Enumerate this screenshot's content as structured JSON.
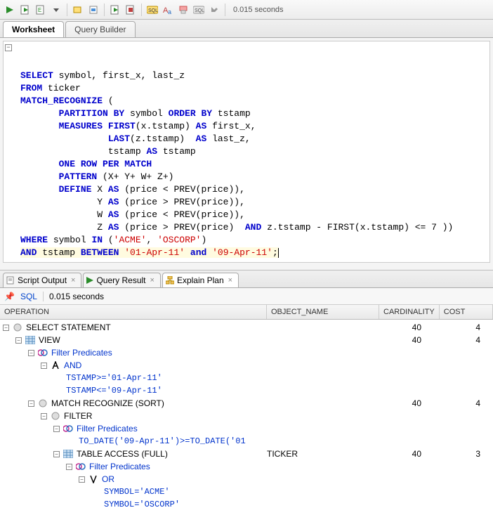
{
  "toolbar": {
    "time": "0.015 seconds"
  },
  "ws_tabs": {
    "worksheet": "Worksheet",
    "query_builder": "Query Builder"
  },
  "sql": {
    "l1a": "SELECT",
    "l1b": " symbol, first_x, last_z",
    "l2a": "FROM",
    "l2b": " ticker",
    "l3a": "MATCH_RECOGNIZE",
    "l3b": " (",
    "l4a": "       PARTITION BY",
    "l4b": " symbol ",
    "l4c": "ORDER BY",
    "l4d": " tstamp",
    "l5a": "       MEASURES",
    "l5b": " FIRST",
    "l5c": "(x.tstamp) ",
    "l5d": "AS",
    "l5e": " first_x,",
    "l6a": "                LAST",
    "l6b": "(z.tstamp)  ",
    "l6c": "AS",
    "l6d": " last_z,",
    "l7a": "                tstamp ",
    "l7b": "AS",
    "l7c": " tstamp",
    "l8a": "       ONE ROW PER MATCH",
    "l9a": "       PATTERN",
    "l9b": " (X+ Y+ W+ Z+)",
    "l10a": "       DEFINE",
    "l10b": " X ",
    "l10c": "AS",
    "l10d": " (price < PREV(price)),",
    "l11a": "              Y ",
    "l11b": "AS",
    "l11c": " (price > PREV(price)),",
    "l12a": "              W ",
    "l12b": "AS",
    "l12c": " (price < PREV(price)),",
    "l13a": "              Z ",
    "l13b": "AS",
    "l13c": " (price > PREV(price)  ",
    "l13d": "AND",
    "l13e": " z.tstamp - FIRST(x.tstamp) <= 7 ))",
    "l14a": "WHERE",
    "l14b": " symbol ",
    "l14c": "IN",
    "l14d": " (",
    "l14e": "'ACME'",
    "l14f": ", ",
    "l14g": "'OSCORP'",
    "l14h": ")",
    "l15a": "AND",
    "l15b": " tstamp ",
    "l15c": "BETWEEN",
    "l15d": " ",
    "l15e": "'01-Apr-11'",
    "l15f": " ",
    "l15g": "and",
    "l15h": " ",
    "l15i": "'09-Apr-11'",
    "l15j": ";"
  },
  "res_tabs": {
    "script_output": "Script Output",
    "query_result": "Query Result",
    "explain_plan": "Explain Plan"
  },
  "status": {
    "sql": "SQL",
    "time": "0.015 seconds"
  },
  "plan_cols": {
    "operation": "OPERATION",
    "object": "OBJECT_NAME",
    "card": "CARDINALITY",
    "cost": "COST"
  },
  "plan": {
    "r1": {
      "op": "SELECT STATEMENT",
      "card": "40",
      "cost": "4"
    },
    "r2": {
      "op": "VIEW",
      "card": "40",
      "cost": "4"
    },
    "r3": {
      "op": "Filter Predicates"
    },
    "r4": {
      "op": "AND"
    },
    "r5": {
      "op": "TSTAMP>='01-Apr-11'"
    },
    "r6": {
      "op": "TSTAMP<='09-Apr-11'"
    },
    "r7": {
      "op": "MATCH RECOGNIZE (SORT)",
      "card": "40",
      "cost": "4"
    },
    "r8": {
      "op": "FILTER"
    },
    "r9": {
      "op": "Filter Predicates"
    },
    "r10": {
      "op": "TO_DATE('09-Apr-11')>=TO_DATE('01"
    },
    "r11": {
      "op": "TABLE ACCESS (FULL)",
      "obj": "TICKER",
      "card": "40",
      "cost": "3"
    },
    "r12": {
      "op": "Filter Predicates"
    },
    "r13": {
      "op": "OR"
    },
    "r14": {
      "op": "SYMBOL='ACME'"
    },
    "r15": {
      "op": "SYMBOL='OSCORP'"
    }
  }
}
